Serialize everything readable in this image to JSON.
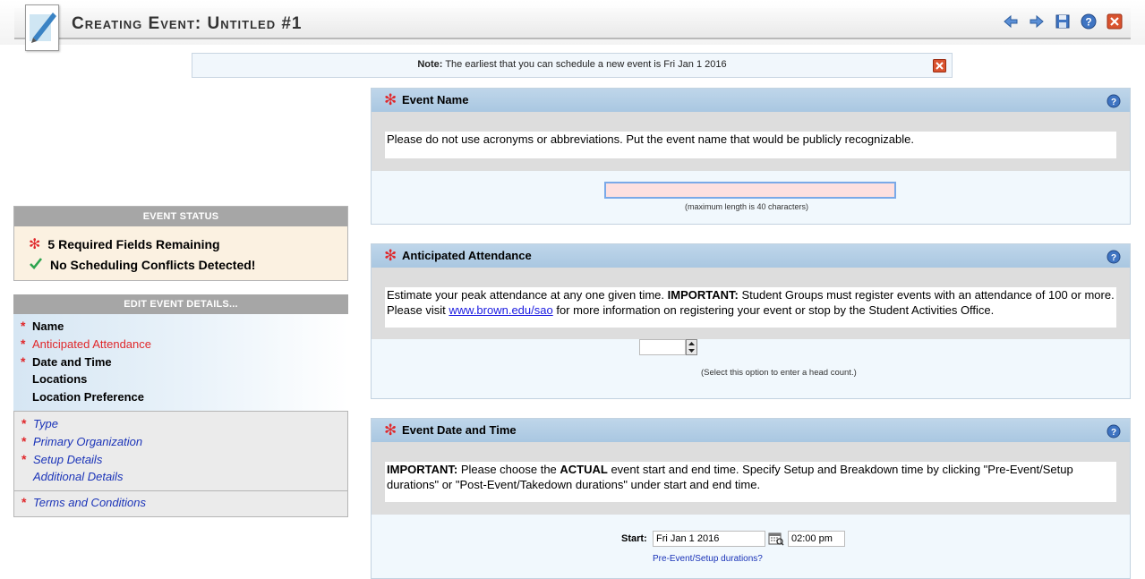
{
  "header": {
    "title": "Creating Event: Untitled #1",
    "icons": [
      "back-arrow-icon",
      "forward-arrow-icon",
      "save-icon",
      "help-icon",
      "close-icon"
    ]
  },
  "note": {
    "label": "Note:",
    "text": "The earliest that you can schedule a new event is Fri Jan 1 2016"
  },
  "status": {
    "title": "Event Status",
    "required": "5 Required Fields Remaining",
    "conflicts": "No Scheduling Conflicts Detected!"
  },
  "edit": {
    "title": "Edit Event Details...",
    "section1": [
      {
        "label": "Name",
        "required": true
      },
      {
        "label": "Anticipated Attendance",
        "required": true
      },
      {
        "label": "Date and Time",
        "required": true
      },
      {
        "label": "Locations",
        "required": false
      },
      {
        "label": "Location Preference",
        "required": false
      }
    ],
    "section2": [
      {
        "label": "Type",
        "required": true
      },
      {
        "label": "Primary Organization",
        "required": true
      },
      {
        "label": "Setup Details",
        "required": true
      },
      {
        "label": "Additional Details",
        "required": false
      }
    ],
    "section3": [
      {
        "label": "Terms and Conditions",
        "required": true
      }
    ]
  },
  "sections": {
    "event_name": {
      "title": "Event Name",
      "desc": "Please do not use acronyms or abbreviations. Put the event name that would be publicly recognizable.",
      "input_value": "",
      "hint": "(maximum length is 40 characters)"
    },
    "attendance": {
      "title": "Anticipated Attendance",
      "important": "IMPORTANT:",
      "desc_pre": "Estimate your peak attendance at any one given time. ",
      "desc_mid": " Student Groups must register events with an attendance of 100 or more. Please visit ",
      "link": "www.brown.edu/sao",
      "desc_post": " for more information on registering your event or stop by the Student Activities Office.",
      "input_value": "",
      "hint": "(Select this option to enter a head count.)"
    },
    "date_time": {
      "title": "Event Date and Time",
      "important": "IMPORTANT:",
      "desc_a": " Please choose the ",
      "actual": "ACTUAL",
      "desc_b": " event start and end time. Specify Setup and Breakdown time by clicking \"Pre-Event/Setup durations\" or \"Post-Event/Takedown durations\" under start and end time.",
      "start_label": "Start:",
      "start_date": "Fri Jan 1 2016",
      "start_time": "02:00 pm",
      "pre_link": "Pre-Event/Setup durations?"
    }
  },
  "colors": {
    "required_star": "#e0282b",
    "section_header": "#a9c7e1",
    "link_blue": "#1a33b8"
  }
}
